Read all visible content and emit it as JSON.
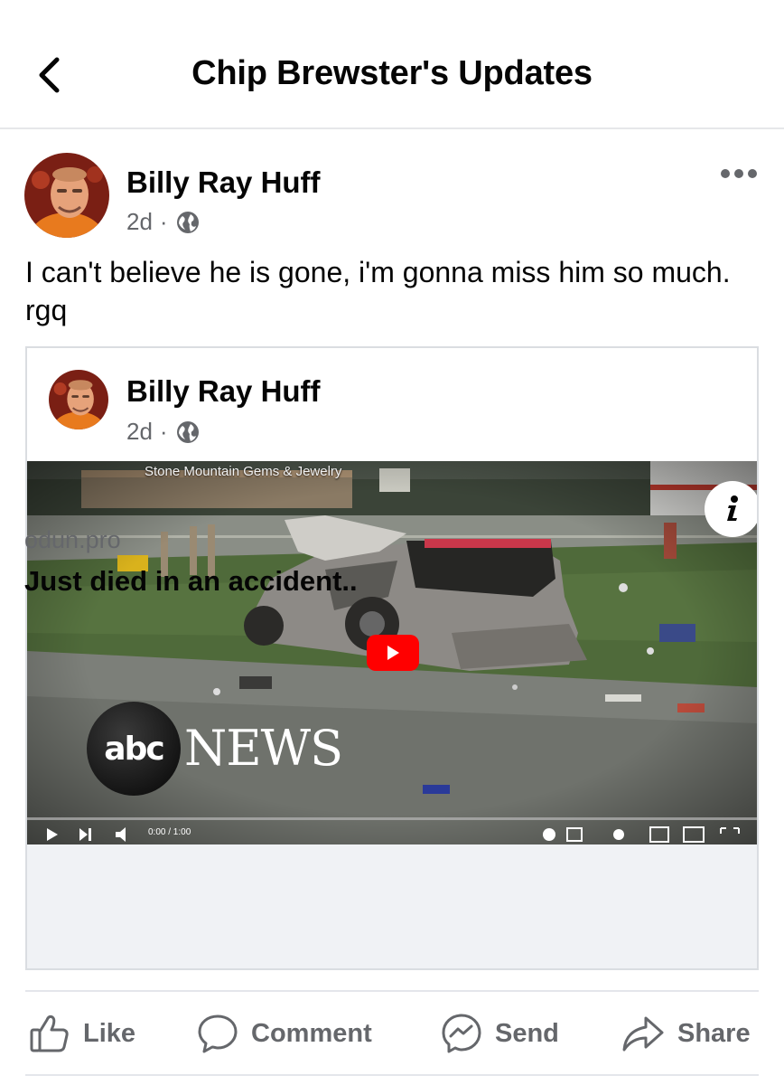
{
  "header": {
    "title": "Chip Brewster's Updates",
    "back_icon": "chevron-left-icon"
  },
  "post": {
    "author": "Billy Ray Huff",
    "time": "2d",
    "separator": "·",
    "audience_icon": "globe-icon",
    "menu_icon": "more-horizontal-icon",
    "text": "I can't believe he is gone, i'm gonna miss him so much. rgq"
  },
  "shared": {
    "author": "Billy Ray Huff",
    "time": "2d",
    "separator": "·",
    "audience_icon": "globe-icon",
    "video": {
      "sign_text": "Stone Mountain Gems & Jewelry",
      "logo_text": "abc",
      "news_text": "NEWS",
      "time_display": "0:00 / 1:00",
      "info_icon": "info-icon",
      "play_icon": "youtube-play-icon"
    },
    "link_domain": "odun.pro",
    "link_title": "Just died in an accident.."
  },
  "actions": [
    {
      "label": "Like",
      "icon": "thumbs-up-icon"
    },
    {
      "label": "Comment",
      "icon": "comment-icon"
    },
    {
      "label": "Send",
      "icon": "messenger-icon"
    },
    {
      "label": "Share",
      "icon": "share-icon"
    }
  ],
  "colors": {
    "text": "#050505",
    "secondary": "#65676b",
    "youtube_red": "#ff0000",
    "divider": "#e4e6eb"
  }
}
